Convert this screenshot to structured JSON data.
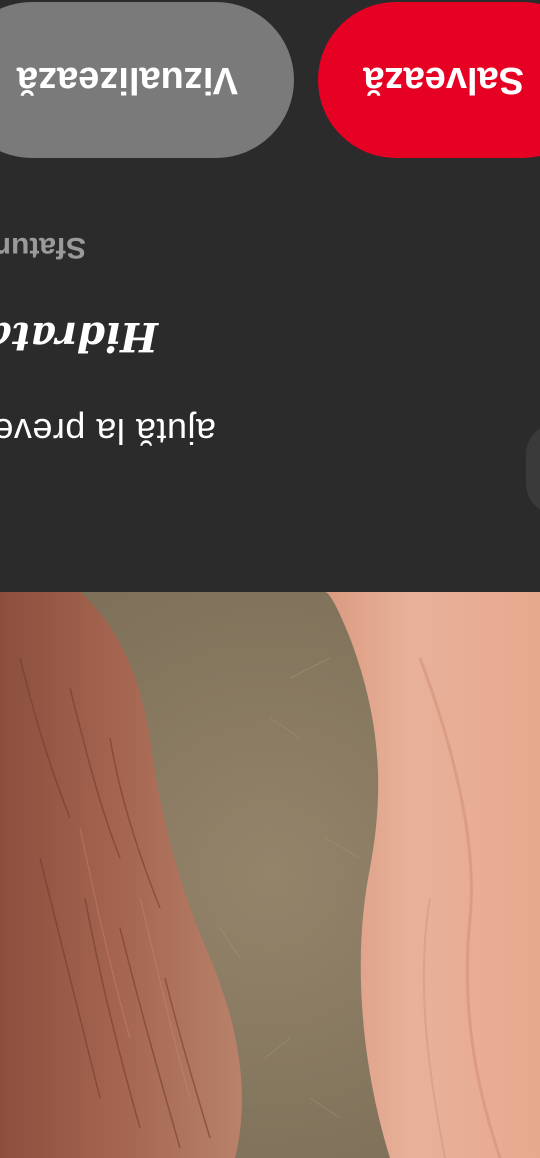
{
  "panel": {
    "subtitle": "ajută la prevenirea",
    "title": "Hidratare zilnică",
    "section_label": "Sfaturi"
  },
  "actions": {
    "save_label": "Salvează",
    "view_label": "Vizualizează"
  },
  "colors": {
    "panel_background": "#2b2b2b",
    "save_button": "#e60023",
    "view_button": "#7a7a7a"
  },
  "photo": {
    "description_icon": "hands-photo"
  }
}
